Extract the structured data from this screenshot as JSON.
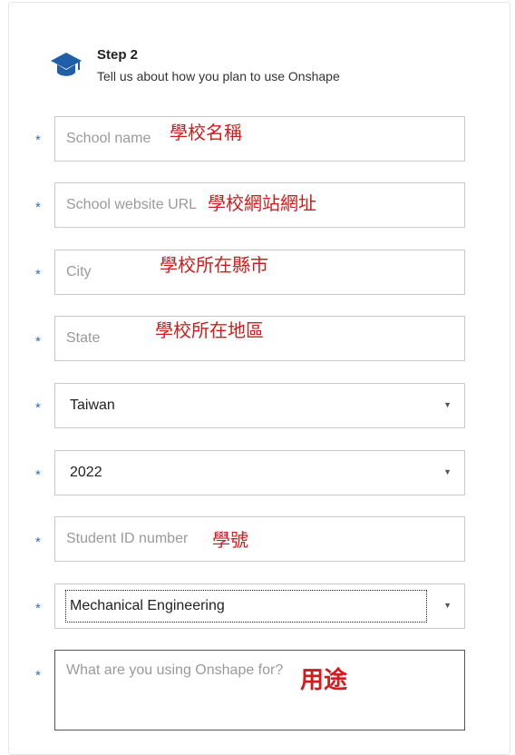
{
  "header": {
    "icon": "graduation-cap-icon",
    "title": "Step 2",
    "subtitle": "Tell us about how you plan to use Onshape"
  },
  "required_mark": "*",
  "colors": {
    "accent": "#1f5fa8",
    "annotation": "#d01c1c",
    "required": "#2e6fb7"
  },
  "fields": {
    "school_name": {
      "placeholder": "School name",
      "annotation": "學校名稱"
    },
    "school_website": {
      "placeholder": "School website URL",
      "annotation": "學校網站網址"
    },
    "city": {
      "placeholder": "City",
      "annotation": "學校所在縣市"
    },
    "state": {
      "placeholder": "State",
      "annotation": "學校所在地區"
    },
    "country": {
      "value": "Taiwan",
      "dropdown_icon": "caret-down-icon"
    },
    "year": {
      "value": "2022",
      "dropdown_icon": "caret-down-icon"
    },
    "student_id": {
      "placeholder": "Student ID number",
      "annotation": "學號"
    },
    "major": {
      "value": "Mechanical Engineering",
      "dropdown_icon": "caret-down-icon"
    },
    "usage": {
      "placeholder": "What are you using Onshape for?",
      "annotation": "用途"
    }
  }
}
